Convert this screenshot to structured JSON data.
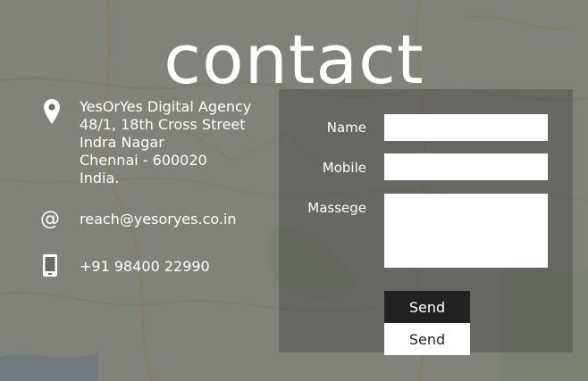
{
  "page": {
    "title": "contact"
  },
  "contact": {
    "address_lines": [
      "YesOrYes Digital Agency",
      "48/1, 18th Cross Street",
      "Indra Nagar",
      "Chennai - 600020",
      "India."
    ],
    "email_symbol": "@",
    "email": "reach@yesoryes.co.in",
    "phone": "+91 98400 22990"
  },
  "form": {
    "name_label": "Name",
    "mobile_label": "Mobile",
    "message_label": "Massege",
    "name_value": "",
    "mobile_value": "",
    "message_value": "",
    "send_label": "Send",
    "send_hover_label": "Send"
  },
  "icons": {
    "location": "map-pin-icon",
    "email": "at-sign-icon",
    "phone": "mobile-phone-icon"
  }
}
